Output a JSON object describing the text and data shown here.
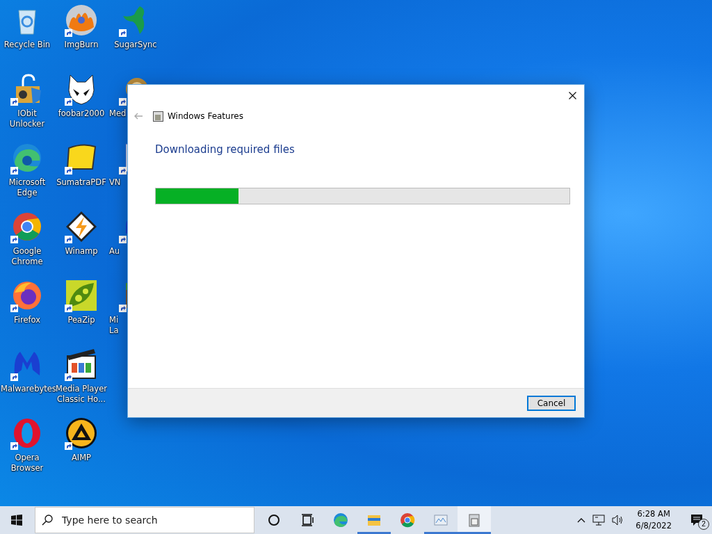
{
  "desktop": {
    "columns": [
      {
        "icons": [
          {
            "label": "Recycle Bin",
            "shortcut": false
          },
          {
            "label": "IObit Unlocker",
            "shortcut": true
          },
          {
            "label": "Microsoft Edge",
            "shortcut": true
          },
          {
            "label": "Google Chrome",
            "shortcut": true
          },
          {
            "label": "Firefox",
            "shortcut": true
          },
          {
            "label": "Malwarebytes",
            "shortcut": true
          },
          {
            "label": "Opera Browser",
            "shortcut": true
          }
        ]
      },
      {
        "icons": [
          {
            "label": "ImgBurn",
            "shortcut": true
          },
          {
            "label": "foobar2000",
            "shortcut": true
          },
          {
            "label": "SumatraPDF",
            "shortcut": true
          },
          {
            "label": "Winamp",
            "shortcut": true
          },
          {
            "label": "PeaZip",
            "shortcut": true
          },
          {
            "label": "Media Player Classic Ho...",
            "shortcut": true
          },
          {
            "label": "AIMP",
            "shortcut": true
          }
        ]
      },
      {
        "icons": [
          {
            "label": "SugarSync",
            "shortcut": true
          },
          {
            "label": "Med",
            "shortcut": true
          },
          {
            "label": "VN",
            "shortcut": true
          },
          {
            "label": "Au",
            "shortcut": true
          },
          {
            "label": "Mi La",
            "shortcut": true
          }
        ]
      }
    ]
  },
  "dialog": {
    "title": "Windows Features",
    "heading": "Downloading required files",
    "progress": {
      "level": 0.2
    },
    "buttons": [
      {
        "label": "Cancel",
        "selected": true
      }
    ]
  },
  "taskbar": {
    "search": {
      "placeholder": "Type here to search"
    },
    "apps": [
      {
        "kind": "cortana",
        "running": false,
        "selected": false
      },
      {
        "kind": "task-view",
        "running": false,
        "selected": false
      },
      {
        "kind": "edge",
        "running": false,
        "selected": false
      },
      {
        "kind": "explorer",
        "running": true,
        "selected": false
      },
      {
        "kind": "chrome",
        "running": false,
        "selected": false
      },
      {
        "kind": "photos",
        "running": true,
        "selected": false
      },
      {
        "kind": "features",
        "running": true,
        "selected": true
      }
    ],
    "clock": {
      "time": "6:28 AM",
      "date": "6/8/2022"
    },
    "notifications": {
      "count": "2"
    }
  }
}
